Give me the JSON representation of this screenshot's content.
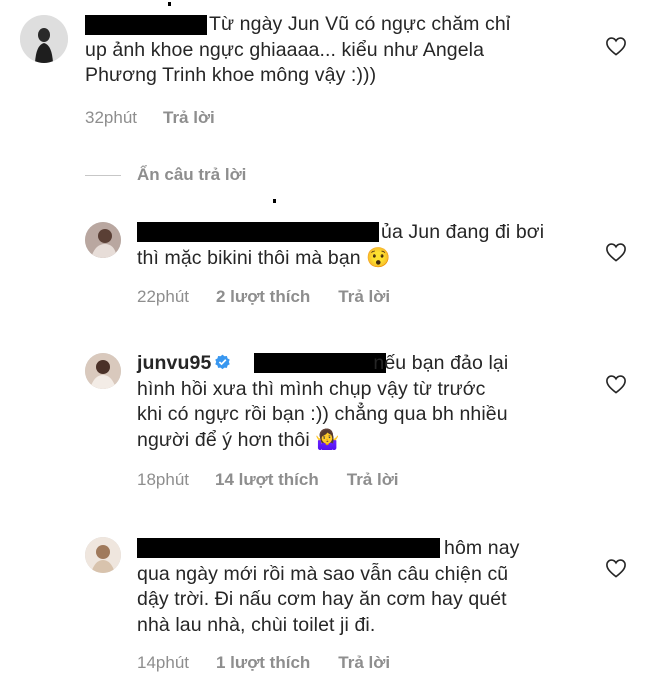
{
  "comments": [
    {
      "text_lines": [
        "Từ ngày Jun Vũ có ngực chăm chỉ",
        "up ảnh khoe ngực ghiaaaa... kiểu như Angela",
        "Phương Trinh khoe mông vậy :)))"
      ],
      "time": "32phút",
      "likes": "",
      "reply": "Trả lời"
    },
    {
      "text_lines": [
        "ủa Jun đang đi bơi",
        "thì mặc bikini thôi mà bạn 😯"
      ],
      "time": "22phút",
      "likes": "2 lượt thích",
      "reply": "Trả lời"
    },
    {
      "username": "junvu95",
      "text_lines": [
        "nếu bạn đảo lại",
        "hình hồi xưa thì mình chụp vậy từ trước",
        "khi có ngực rồi bạn :)) chẳng qua bh nhiều",
        "người để ý hơn thôi 🤷‍♀️"
      ],
      "time": "18phút",
      "likes": "14 lượt thích",
      "reply": "Trả lời"
    },
    {
      "text_lines": [
        "hôm nay",
        "qua ngày mới rồi mà sao vẫn câu chiện cũ",
        "dậy trời. Đi nấu cơm hay ăn cơm hay quét",
        "nhà lau nhà, chùi toilet ji đi."
      ],
      "time": "14phút",
      "likes": "1 lượt thích",
      "reply": "Trả lời"
    }
  ],
  "hide_replies": "Ẩn câu trả lời",
  "icons": {
    "like": "heart-outline-icon",
    "verified": "verified-badge-icon"
  },
  "colors": {
    "text": "#262626",
    "meta": "#8e8e8e",
    "verified": "#3897f0"
  }
}
